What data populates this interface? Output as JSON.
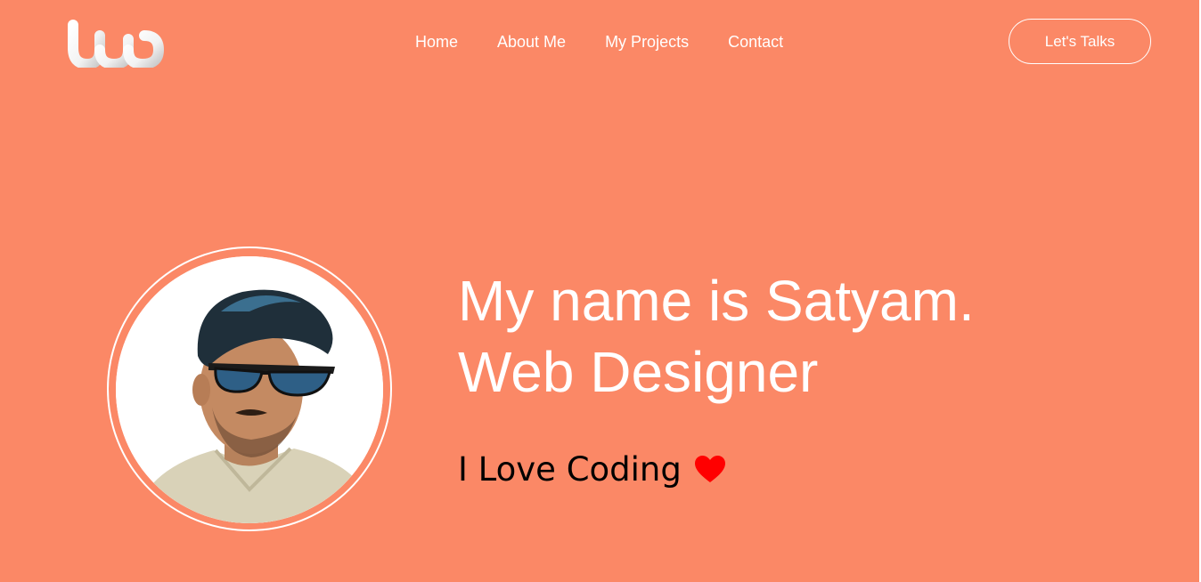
{
  "header": {
    "logo_text": "wd",
    "nav": [
      {
        "label": "Home"
      },
      {
        "label": "About Me"
      },
      {
        "label": "My Projects"
      },
      {
        "label": "Contact"
      }
    ],
    "cta_label": "Let's Talks"
  },
  "hero": {
    "title_line1": "My name is Satyam.",
    "title_line2": "Web Designer",
    "tagline": "I Love Coding",
    "tagline_icon": "heart-icon"
  },
  "colors": {
    "background": "#fb8866",
    "text": "#ffffff",
    "tagline": "#000000",
    "heart": "#ff0000"
  }
}
